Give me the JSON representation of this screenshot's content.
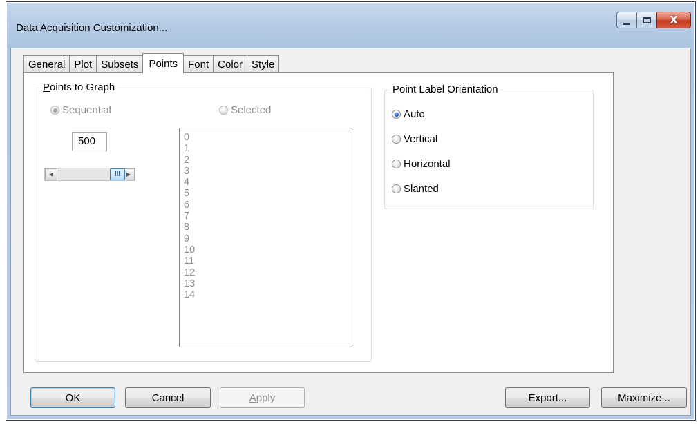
{
  "window": {
    "title": "Data Acquisition Customization..."
  },
  "titlebar_buttons": {
    "close_glyph": "X"
  },
  "tabs": [
    {
      "label": "General",
      "active": false
    },
    {
      "label": "Plot",
      "active": false
    },
    {
      "label": "Subsets",
      "active": false
    },
    {
      "label": "Points",
      "active": true
    },
    {
      "label": "Font",
      "active": false
    },
    {
      "label": "Color",
      "active": false
    },
    {
      "label": "Style",
      "active": false
    }
  ],
  "points_to_graph": {
    "label_first": "P",
    "label_rest": "oints to Graph",
    "sequential_label": "Sequential",
    "selected_label": "Selected",
    "count_value": "500",
    "scroll_thumb_glyph": "III",
    "list_items": [
      "0",
      "1",
      "2",
      "3",
      "4",
      "5",
      "6",
      "7",
      "8",
      "9",
      "10",
      "11",
      "12",
      "13",
      "14"
    ]
  },
  "orientation": {
    "label": "Point Label Orientation",
    "options": [
      {
        "label": "Auto",
        "checked": true
      },
      {
        "label": "Vertical",
        "checked": false
      },
      {
        "label": "Horizontal",
        "checked": false
      },
      {
        "label": "Slanted",
        "checked": false
      }
    ]
  },
  "buttons": {
    "ok": "OK",
    "cancel": "Cancel",
    "apply_first": "A",
    "apply_rest": "pply",
    "export": "Export...",
    "maximize": "Maximize..."
  },
  "colors": {
    "accent": "#1a5fc2",
    "close_button": "#c43c1f",
    "disabled_text": "#8d8d8d"
  },
  "icons": {
    "close": "close-icon",
    "maximize": "maximize-icon",
    "minimize": "minimize-icon"
  }
}
